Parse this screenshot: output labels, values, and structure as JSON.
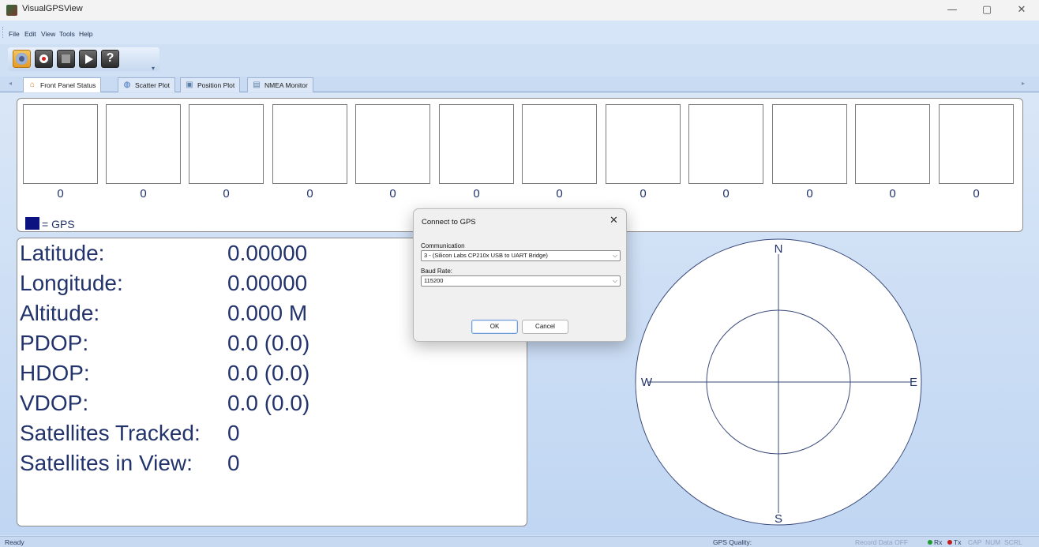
{
  "window": {
    "title": "VisualGPSView",
    "minimize": "—",
    "restore": "▢",
    "close": "✕"
  },
  "menu": [
    "File",
    "Edit",
    "View",
    "Tools",
    "Help"
  ],
  "toolbar": {
    "help_label": "?"
  },
  "tabs": [
    {
      "label": "Front Panel Status",
      "icon": "home-icon",
      "active": true
    },
    {
      "label": "Scatter Plot",
      "icon": "globe-icon",
      "active": false
    },
    {
      "label": "Position Plot",
      "icon": "picture-icon",
      "active": false
    },
    {
      "label": "NMEA Monitor",
      "icon": "monitor-icon",
      "active": false
    }
  ],
  "satellites": {
    "values": [
      "0",
      "0",
      "0",
      "0",
      "0",
      "0",
      "0",
      "0",
      "0",
      "0",
      "0",
      "0"
    ],
    "legend": "= GPS",
    "legend_color": "#0c1280"
  },
  "info": {
    "rows": [
      {
        "label": "Latitude:",
        "value": "0.00000"
      },
      {
        "label": "Longitude:",
        "value": "0.00000"
      },
      {
        "label": "Altitude:",
        "value": "0.000 M"
      },
      {
        "label": "PDOP:",
        "value": "0.0 (0.0)"
      },
      {
        "label": "HDOP:",
        "value": "0.0 (0.0)"
      },
      {
        "label": "VDOP:",
        "value": "0.0 (0.0)"
      },
      {
        "label": "Satellites Tracked:",
        "value": "0"
      },
      {
        "label": "Satellites in View:",
        "value": "0"
      }
    ]
  },
  "compass": {
    "north": "N",
    "south": "S",
    "east": "E",
    "west": "W"
  },
  "status": {
    "ready": "Ready",
    "quality": "GPS Quality:",
    "record": "Record Data OFF",
    "rx": "Rx",
    "tx": "Tx",
    "cap": "CAP",
    "num": "NUM",
    "scrl": "SCRL"
  },
  "dialog": {
    "title": "Connect to GPS",
    "close": "✕",
    "communication_label": "Communication",
    "communication_value": "3 - (Silicon Labs CP210x USB to UART Bridge)",
    "baud_label": "Baud Rate:",
    "baud_value": "115200",
    "ok": "OK",
    "cancel": "Cancel"
  },
  "colors": {
    "text_blue": "#23336b",
    "background": "#cfe0f4"
  }
}
